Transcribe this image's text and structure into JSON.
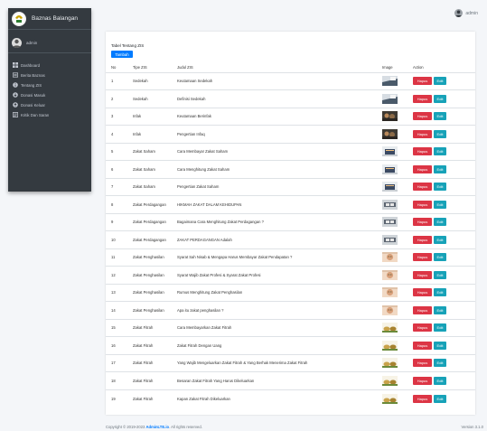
{
  "sidebar": {
    "brand": "Baznas Balangan",
    "user": "admin",
    "items": [
      {
        "label": "Dashboard",
        "icon": "dashboard-icon"
      },
      {
        "label": "Berita Baznas",
        "icon": "newspaper-icon"
      },
      {
        "label": "Tentang ZIS",
        "icon": "info-icon"
      },
      {
        "label": "Donasi Masuk",
        "icon": "donation-in-icon"
      },
      {
        "label": "Donasi Keluar",
        "icon": "donation-out-icon"
      },
      {
        "label": "Kritik Dan Saran",
        "icon": "feedback-icon"
      }
    ]
  },
  "topbar": {
    "user": "admin"
  },
  "card": {
    "title": "Tabel Tentang ZIS",
    "add_label": "Tambah",
    "headers": [
      "No",
      "Tipe ZIS",
      "Judul ZIS",
      "Image",
      "Action"
    ],
    "delete_label": "Hapus",
    "edit_label": "Edit",
    "rows": [
      {
        "no": "1",
        "tipe": "Sedekah",
        "judul": "Keutamaan Sedekah",
        "image": "sedekah-image"
      },
      {
        "no": "2",
        "tipe": "Sedekah",
        "judul": "Definisi Sedekah",
        "image": "sedekah-image"
      },
      {
        "no": "3",
        "tipe": "Infak",
        "judul": "Keutamaan Berinfak",
        "image": "infak-image"
      },
      {
        "no": "4",
        "tipe": "Infak",
        "judul": "Pengertian Infaq",
        "image": "infak-image"
      },
      {
        "no": "5",
        "tipe": "Zakat Saham",
        "judul": "Cara Membayar Zakat Saham",
        "image": "saham-image"
      },
      {
        "no": "6",
        "tipe": "Zakat Saham",
        "judul": "Cara Menghitung Zakat Saham",
        "image": "saham-image"
      },
      {
        "no": "7",
        "tipe": "Zakat Saham",
        "judul": "Pengertian Zakat Saham",
        "image": "saham-image"
      },
      {
        "no": "8",
        "tipe": "Zakat Perdagangan",
        "judul": "HIKMAH ZAKAT DALAM KEHIDUPAN",
        "image": "perdagangan-image"
      },
      {
        "no": "9",
        "tipe": "Zakat Perdagangan",
        "judul": "Bagaimana Cara Menghitung Zakat Perdagangan ?",
        "image": "perdagangan-image"
      },
      {
        "no": "10",
        "tipe": "Zakat Perdagangan",
        "judul": "ZAKAT PERDAGANGAN Adalah",
        "image": "perdagangan-image"
      },
      {
        "no": "11",
        "tipe": "Zakat Penghasilan",
        "judul": "Syarat Sah Nisab & Mengapa Harus Membayar Zakat Pendapatan ?",
        "image": "penghasilan-image"
      },
      {
        "no": "12",
        "tipe": "Zakat Penghasilan",
        "judul": "Syarat Wajib Zakat Profesi & Syarat Zakat Profesi",
        "image": "penghasilan-image"
      },
      {
        "no": "13",
        "tipe": "Zakat Penghasilan",
        "judul": "Rumus Menghitung Zakat Penghasilan",
        "image": "penghasilan-image"
      },
      {
        "no": "14",
        "tipe": "Zakat Penghasilan",
        "judul": "Apa itu zakat penghasilan ?",
        "image": "penghasilan-image"
      },
      {
        "no": "15",
        "tipe": "Zakat Fitrah",
        "judul": "Cara Membayarkan Zakat Fitrah",
        "image": "fitrah-image"
      },
      {
        "no": "16",
        "tipe": "Zakat Fitrah",
        "judul": "Zakat Fitrah Dengan Uang",
        "image": "fitrah-image"
      },
      {
        "no": "17",
        "tipe": "Zakat Fitrah",
        "judul": "Yang Wajib Mengeluarkan Zakat Fitrah & Yang Berhak Menerima Zakat Fitrah",
        "image": "fitrah-image"
      },
      {
        "no": "18",
        "tipe": "Zakat Fitrah",
        "judul": "Besaran Zakat Fitrah Yang Harus Dikeluarkan",
        "image": "fitrah-image"
      },
      {
        "no": "19",
        "tipe": "Zakat Fitrah",
        "judul": "Kapan Zakat Fitrah Dikeluarkan",
        "image": "fitrah-image"
      }
    ]
  },
  "footer": {
    "copyright_prefix": "Copyright © 2019-2023 ",
    "brand_link": "AdminLTE.io",
    "copyright_suffix": ". All rights reserved.",
    "version": "Version 3.1.0"
  },
  "colors": {
    "sidebar": "#343a40",
    "primary": "#007bff",
    "danger": "#dc3545",
    "info": "#17a2b8"
  }
}
